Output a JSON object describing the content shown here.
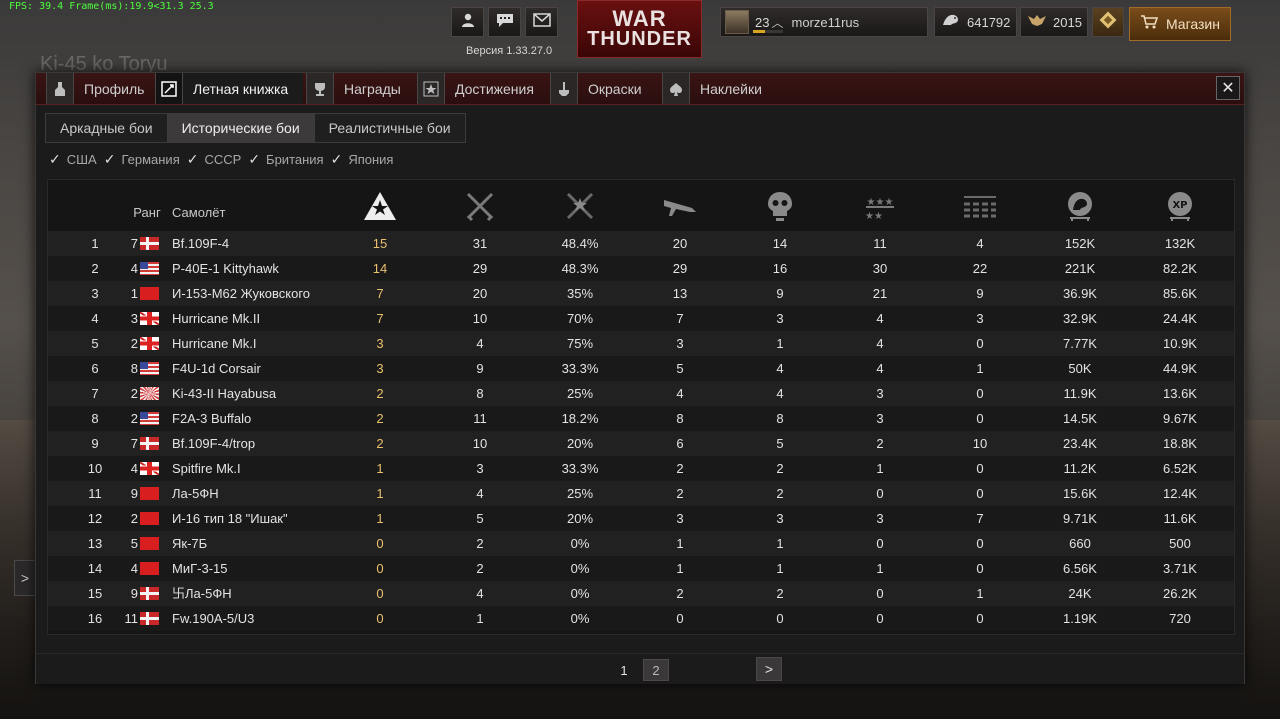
{
  "fps_text": "FPS: 39.4 Frame(ms):19.9<31.3 25.3",
  "version": "Версия 1.33.27.0",
  "logo": {
    "line1": "WAR",
    "line2": "THUNDER"
  },
  "player": {
    "level": "23",
    "name": "morze11rus",
    "level_progress": 0.4
  },
  "currency": {
    "silver": "641792",
    "gold": "2015"
  },
  "shop_label": "Магазин",
  "background_title": "Ki-45 ko Toryu",
  "tabs": [
    {
      "label": "Профиль",
      "icon": "profile-icon"
    },
    {
      "label": "Летная книжка",
      "icon": "logbook-icon",
      "active": true
    },
    {
      "label": "Награды",
      "icon": "trophy-icon"
    },
    {
      "label": "Достижения",
      "icon": "achievement-icon"
    },
    {
      "label": "Окраски",
      "icon": "paint-icon"
    },
    {
      "label": "Наклейки",
      "icon": "decal-icon"
    }
  ],
  "modes": [
    {
      "label": "Аркадные бои"
    },
    {
      "label": "Исторические бои",
      "active": true
    },
    {
      "label": "Реалистичные бои"
    }
  ],
  "filters": [
    "США",
    "Германия",
    "СССР",
    "Британия",
    "Япония"
  ],
  "table": {
    "headers": {
      "rank": "Ранг",
      "plane": "Самолёт"
    },
    "stat_icons": [
      "victories-icon",
      "battles-icon",
      "win-rate-icon",
      "air-kills-icon",
      "deaths-icon",
      "ground-kills-icon",
      "naval-kills-icon",
      "silver-lions-icon",
      "xp-icon"
    ],
    "rows": [
      [
        "1",
        "7",
        "germany",
        "Bf.109F-4",
        "15",
        "31",
        "48.4%",
        "20",
        "14",
        "11",
        "4",
        "152K",
        "132K"
      ],
      [
        "2",
        "4",
        "usa",
        "P-40E-1 Kittyhawk",
        "14",
        "29",
        "48.3%",
        "29",
        "16",
        "30",
        "22",
        "221K",
        "82.2K"
      ],
      [
        "3",
        "1",
        "ussr",
        "И-153-М62 Жуковского",
        "7",
        "20",
        "35%",
        "13",
        "9",
        "21",
        "9",
        "36.9K",
        "85.6K"
      ],
      [
        "4",
        "3",
        "britain",
        "Hurricane Mk.II",
        "7",
        "10",
        "70%",
        "7",
        "3",
        "4",
        "3",
        "32.9K",
        "24.4K"
      ],
      [
        "5",
        "2",
        "britain",
        "Hurricane Mk.I",
        "3",
        "4",
        "75%",
        "3",
        "1",
        "4",
        "0",
        "7.77K",
        "10.9K"
      ],
      [
        "6",
        "8",
        "usa",
        "F4U-1d Corsair",
        "3",
        "9",
        "33.3%",
        "5",
        "4",
        "4",
        "1",
        "50K",
        "44.9K"
      ],
      [
        "7",
        "2",
        "japan",
        "Ki-43-II Hayabusa",
        "2",
        "8",
        "25%",
        "4",
        "4",
        "3",
        "0",
        "11.9K",
        "13.6K"
      ],
      [
        "8",
        "2",
        "usa",
        "F2A-3 Buffalo",
        "2",
        "11",
        "18.2%",
        "8",
        "8",
        "3",
        "0",
        "14.5K",
        "9.67K"
      ],
      [
        "9",
        "7",
        "germany",
        "Bf.109F-4/trop",
        "2",
        "10",
        "20%",
        "6",
        "5",
        "2",
        "10",
        "23.4K",
        "18.8K"
      ],
      [
        "10",
        "4",
        "britain",
        "Spitfire Mk.I",
        "1",
        "3",
        "33.3%",
        "2",
        "2",
        "1",
        "0",
        "11.2K",
        "6.52K"
      ],
      [
        "11",
        "9",
        "ussr",
        "Ла-5ФН",
        "1",
        "4",
        "25%",
        "2",
        "2",
        "0",
        "0",
        "15.6K",
        "12.4K"
      ],
      [
        "12",
        "2",
        "ussr",
        "И-16 тип 18 \"Ишак\"",
        "1",
        "5",
        "20%",
        "3",
        "3",
        "3",
        "7",
        "9.71K",
        "11.6K"
      ],
      [
        "13",
        "5",
        "ussr",
        "Як-7Б",
        "0",
        "2",
        "0%",
        "1",
        "1",
        "0",
        "0",
        "660",
        "500"
      ],
      [
        "14",
        "4",
        "ussr",
        "МиГ-3-15",
        "0",
        "2",
        "0%",
        "1",
        "1",
        "1",
        "0",
        "6.56K",
        "3.71K"
      ],
      [
        "15",
        "9",
        "germany",
        "卐Ла-5ФН",
        "0",
        "4",
        "0%",
        "2",
        "2",
        "0",
        "1",
        "24K",
        "26.2K"
      ],
      [
        "16",
        "11",
        "germany",
        "Fw.190A-5/U3",
        "0",
        "1",
        "0%",
        "0",
        "0",
        "0",
        "0",
        "1.19K",
        "720"
      ]
    ]
  },
  "pagination": {
    "current": "1",
    "other": "2"
  },
  "colors": {
    "accent_gold": "#e9c16e",
    "tab_bar": "#3a1414",
    "shop": "#7a4d1a"
  }
}
